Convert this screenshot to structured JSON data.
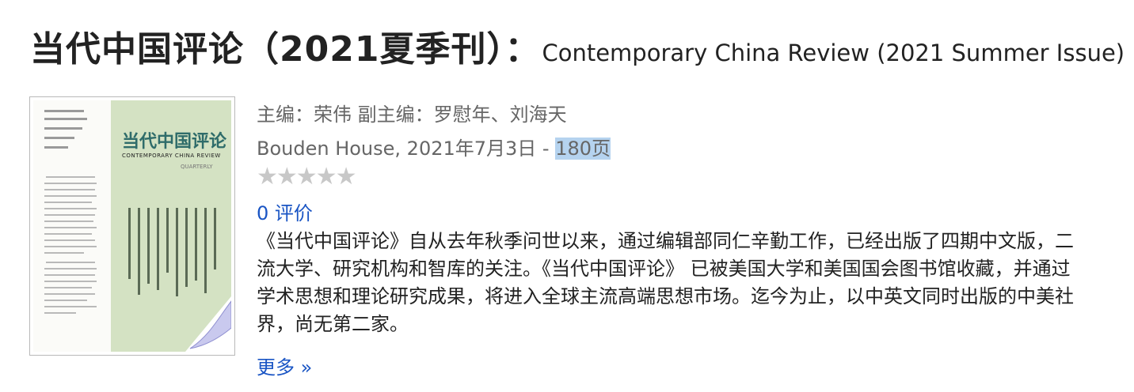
{
  "book": {
    "title_zh": "当代中国评论（2021夏季刊）：",
    "title_en": "Contemporary China Review (2021 Summer Issue)",
    "editors": "主编：荣伟 副主编：罗慰年、刘海天",
    "publisher_date": "Bouden House, 2021年7月3日 - ",
    "pages": "180页",
    "rating_stars": "★★★★★",
    "reviews_link": "0 评价",
    "description_lines": [
      "《当代中国评论》自从去年秋季问世以来，通过编辑部同仁辛勤工作，已经出版了四期中文版，二",
      "流大学、研究机构和智库的关注。《当代中国评论》 已被美国大学和美国国会图书馆收藏，并通过",
      "学术思想和理论研究成果，将进入全球主流高端思想市场。迄今为止，以中英文同时出版的中美社",
      "界，尚无第二家。"
    ],
    "more_link": "更多 »"
  },
  "cover": {
    "title": "当代中国评论",
    "subtitle": "CONTEMPORARY CHINA REVIEW",
    "issue": "QUARTERLY"
  },
  "colors": {
    "link": "#1a55c4",
    "meta_text": "#666666",
    "highlight": "#b5d3ef",
    "cover_band": "#d4e2c3",
    "cover_title": "#2f6c6a"
  }
}
